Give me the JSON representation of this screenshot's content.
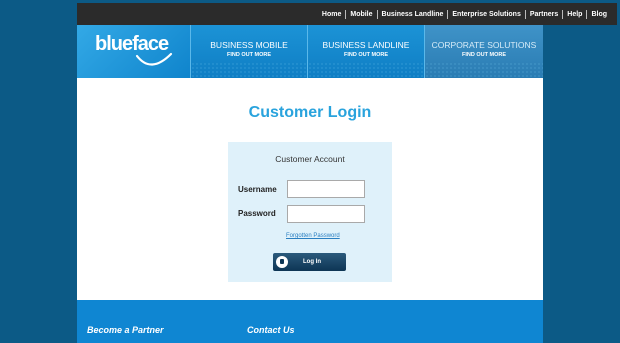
{
  "topnav": {
    "items": [
      "Home",
      "Mobile",
      "Business Landline",
      "Enterprise Solutions",
      "Partners",
      "Help",
      "Blog"
    ]
  },
  "brand": {
    "logo_text": "blueface"
  },
  "promos": [
    {
      "title": "BUSINESS MOBILE",
      "sub": "FIND OUT MORE"
    },
    {
      "title": "BUSINESS LANDLINE",
      "sub": "FIND OUT MORE"
    },
    {
      "title": "CORPORATE SOLUTIONS",
      "sub": "FIND OUT MORE"
    }
  ],
  "page": {
    "title": "Customer Login"
  },
  "login": {
    "box_title": "Customer Account",
    "username_label": "Username",
    "password_label": "Password",
    "username_value": "",
    "password_value": "",
    "forgot_label": "Forgotten Password",
    "button_label": "Log In"
  },
  "footer": {
    "partner_heading": "Become a Partner",
    "contact_heading": "Contact Us"
  },
  "colors": {
    "background": "#0c5a86",
    "accent": "#29a3dd",
    "footer": "#0f86d2"
  }
}
